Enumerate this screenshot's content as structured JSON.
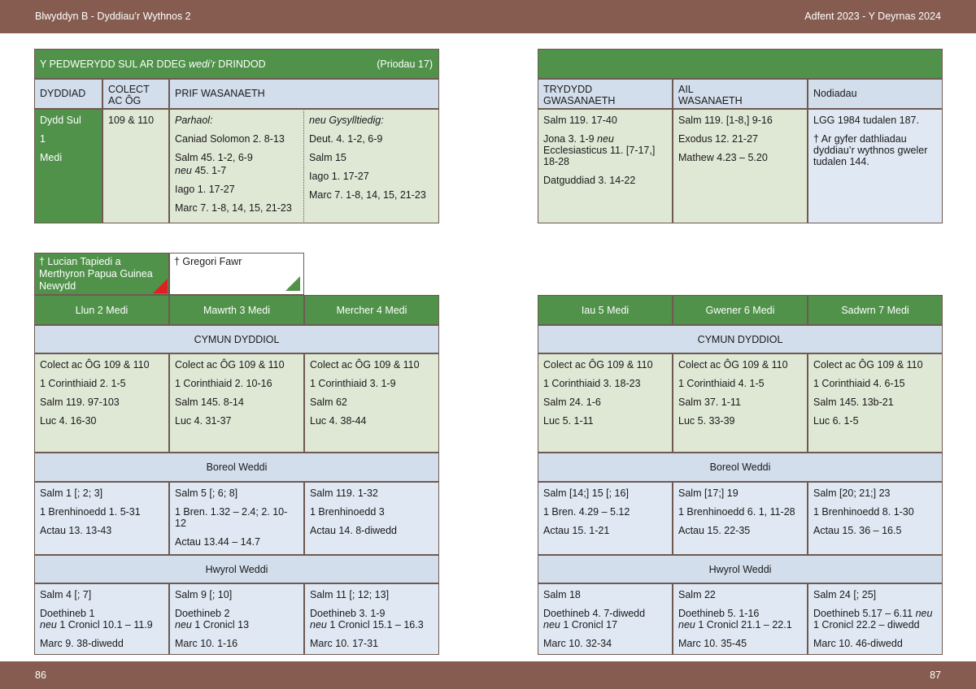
{
  "header": {
    "left": "Blwyddyn  B - Dyddiau’r Wythnos 2",
    "right": "Adfent  2023 - Y Deyrnas 2024"
  },
  "footer": {
    "left_page": "86",
    "right_page": "87"
  },
  "sunday": {
    "title_a": "Y PEDWERYDD SUL AR DDEG ",
    "title_b": "wedi’r",
    "title_c": " DRINDOD",
    "note": "(Priodau 17)",
    "col_headers": [
      "DYDDIAD",
      "COLECT\nAC ÔG",
      "PRIF WASANAETH",
      "TRYDYDD\nGWASANAETH",
      "AIL\nWASANAETH",
      "Nodiadau"
    ],
    "date": [
      "Dydd Sul",
      "1",
      "Medi"
    ],
    "collect": "109 & 110",
    "main_a_head": "Parhaol:",
    "main_a": [
      "Caniad Solomon 2. 8-13",
      "Salm 45. 1-2, 6-9",
      "neu",
      " 45. 1-7",
      "Iago 1. 17-27",
      "Marc 7. 1-8, 14, 15, 21-23"
    ],
    "main_b_head": "neu Gysylltiedig:",
    "main_b": [
      "Deut. 4. 1-2, 6-9",
      "Salm 15",
      "Iago 1. 17-27",
      "Marc 7. 1-8, 14, 15, 21-23"
    ],
    "third": [
      "Salm 119. 17-40",
      "Jona 3. 1-9 ",
      "neu",
      "Ecclesiasticus 11. [7-17,]",
      "18-28",
      "Datguddiad 3. 14-22"
    ],
    "second": [
      "Salm 119. [1-8,] 9-16",
      "Exodus 12. 21-27",
      "Mathew 4.23 – 5.20"
    ],
    "notes": [
      "LGG 1984 tudalen 187.",
      "† Ar gyfer dathliadau dyddiau’r wythnos gweler tudalen 144."
    ]
  },
  "saints": [
    {
      "label": "† Lucian Tapiedi a Merthyron Papua Guinea Newydd",
      "tri_color": "#e02020"
    },
    {
      "label": "† Gregori Fawr",
      "tri_color": "#50924a"
    }
  ],
  "section_labels": {
    "communion": "CYMUN DYDDIOL",
    "morning": "Boreol Weddi",
    "evening": "Hwyrol Weddi"
  },
  "days_left": [
    {
      "name": "Llun 2 Medi",
      "communion": [
        "Colect ac ÔG 109 & 110",
        "1 Corinthiaid 2. 1-5",
        "Salm 119. 97-103",
        "Luc 4. 16-30"
      ],
      "morning": [
        "Salm 1 [; 2; 3]",
        "1 Brenhinoedd 1. 5-31",
        " Actau 13. 13-43"
      ],
      "evening": [
        "Salm 4 [; 7]",
        "Doethineb 1",
        "neu",
        " 1 Cronicl 10.1 – 11.9",
        "Marc 9. 38-diwedd"
      ]
    },
    {
      "name": "Mawrth 3 Medi",
      "communion": [
        "Colect ac ÔG 109 & 110",
        "1 Corinthiaid 2. 10-16",
        "Salm 145. 8-14",
        "Luc 4. 31-37"
      ],
      "morning": [
        "Salm 5 [; 6; 8]",
        "1 Bren. 1.32 – 2.4; 2. 10-12",
        "Actau 13.44 – 14.7"
      ],
      "evening": [
        "Salm 9 [; 10]",
        "Doethineb 2",
        "neu",
        " 1 Cronicl 13",
        "Marc 10. 1-16"
      ]
    },
    {
      "name": "Mercher 4 Medi",
      "communion": [
        "Colect ac ÔG 109 & 110",
        "1 Corinthiaid 3. 1-9",
        "Salm 62",
        "Luc 4. 38-44"
      ],
      "morning": [
        "Salm 119. 1-32",
        "1 Brenhinoedd 3",
        "Actau 14. 8-diwedd"
      ],
      "evening": [
        "Salm 11 [; 12; 13]",
        "Doethineb 3. 1-9",
        "neu",
        " 1 Cronicl 15.1 – 16.3",
        "Marc 10. 17-31"
      ]
    }
  ],
  "days_right": [
    {
      "name": "Iau 5 Medi",
      "communion": [
        "Colect ac ÔG 109 & 110",
        "1 Corinthiaid 3. 18-23",
        "Salm 24. 1-6",
        "Luc 5. 1-11"
      ],
      "morning": [
        "Salm [14;] 15 [; 16]",
        "1 Bren. 4.29 – 5.12",
        "Actau 15. 1-21"
      ],
      "evening": [
        "Salm 18",
        "Doethineb 4. 7-diwedd",
        "neu",
        " 1 Cronicl 17",
        "Marc 10. 32-34"
      ]
    },
    {
      "name": "Gwener 6 Medi",
      "communion": [
        "Colect ac ÔG 109 & 110",
        "1 Corinthiaid 4. 1-5",
        "Salm 37. 1-11",
        "Luc 5. 33-39"
      ],
      "morning": [
        "Salm [17;] 19",
        "1 Brenhinoedd 6. 1, 11-28",
        "Actau 15. 22-35"
      ],
      "evening": [
        "Salm 22",
        "Doethineb 5. 1-16",
        "neu",
        " 1 Cronicl 21.1 – 22.1",
        "Marc 10. 35-45"
      ]
    },
    {
      "name": "Sadwrn 7 Medi",
      "communion": [
        "Colect ac ÔG 109 & 110",
        "1 Corinthiaid 4. 6-15",
        "Salm 145. 13b-21",
        "Luc 6. 1-5"
      ],
      "morning": [
        "Salm [20; 21;] 23",
        "1 Brenhinoedd 8. 1-30",
        "Actau 15. 36 – 16.5"
      ],
      "evening": [
        "Salm 24 [; 25]",
        "Doethineb 5.17 – 6.11 ",
        "neu",
        "1 Cronicl 22.2 – diwedd",
        "Marc 10. 46-diwedd"
      ]
    }
  ]
}
